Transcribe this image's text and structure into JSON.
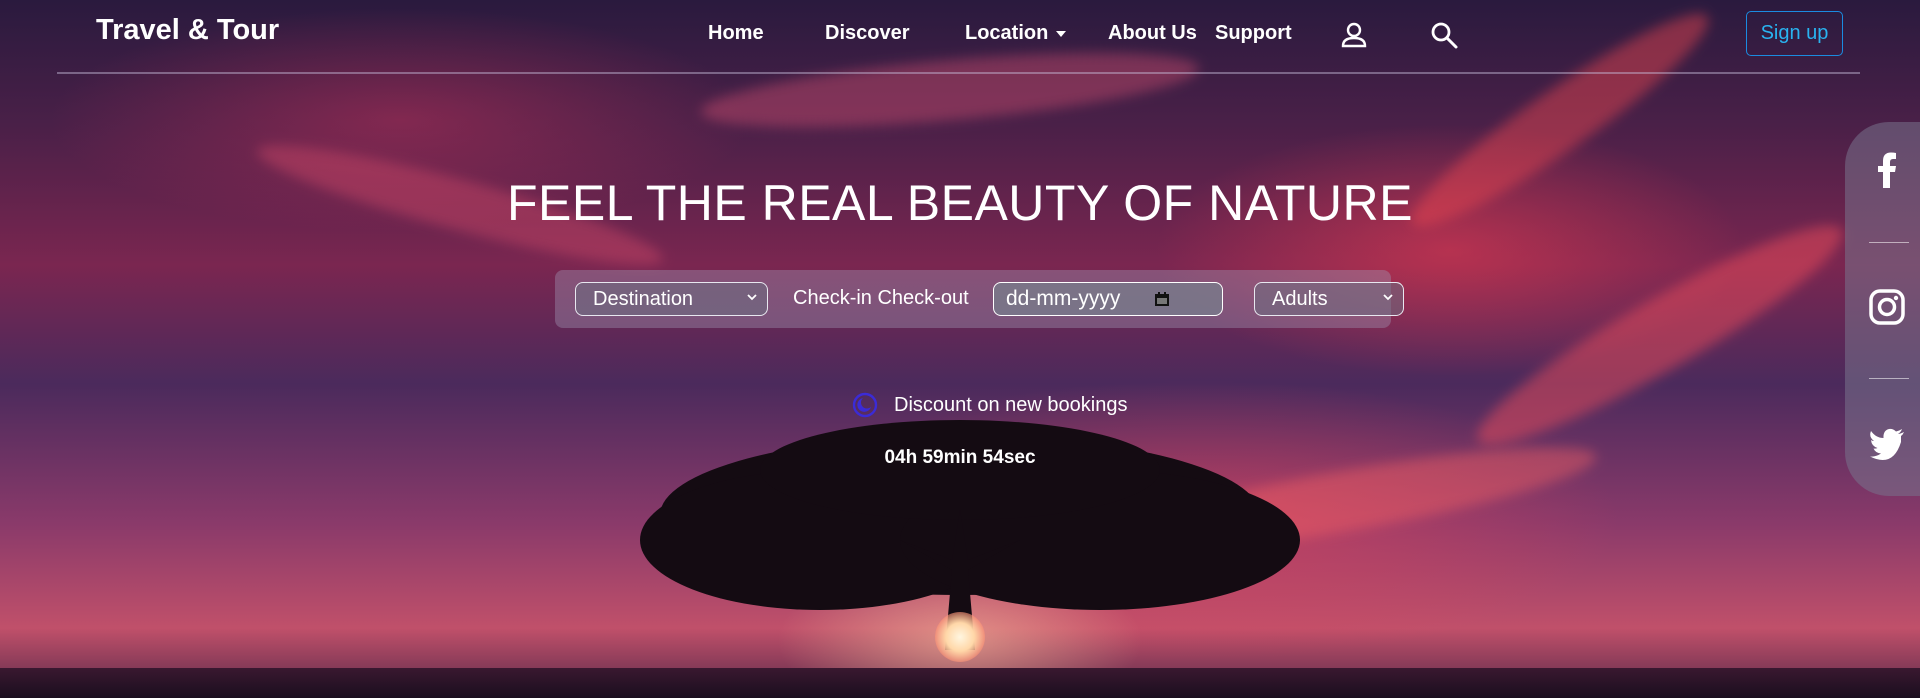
{
  "navbar": {
    "brand": "Travel & Tour",
    "links": [
      {
        "label": "Home"
      },
      {
        "label": "Discover"
      },
      {
        "label": "Location"
      },
      {
        "label": "About Us"
      },
      {
        "label": "Support"
      }
    ],
    "icons": [
      "user-icon",
      "search-icon"
    ],
    "signup_label": "Sign up"
  },
  "hero": {
    "headline": "FEEL THE REAL BEAUTY OF NATURE"
  },
  "search": {
    "destination_selected": "Destination",
    "check_label": "Check-in Check-out",
    "date_value": "dd-mm-yyyy",
    "guests_selected": "Adults"
  },
  "promo": {
    "discount_text": "Discount on new bookings",
    "timer": "04h 59min 54sec"
  },
  "social": {
    "icons": [
      "facebook-icon",
      "instagram-icon",
      "twitter-icon"
    ]
  },
  "colors": {
    "signup_border": "#1b8be0",
    "signup_text": "#29b3f0",
    "discount_icon": "#3b2bd6"
  }
}
